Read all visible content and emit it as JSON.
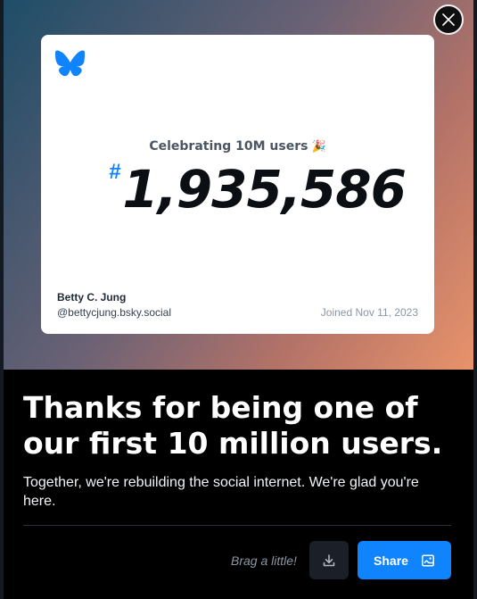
{
  "colors": {
    "accent": "#1083fe",
    "hero_gradient": [
      "#1e4d68",
      "#6c6275",
      "#b37268",
      "#e8936a"
    ]
  },
  "dialog": {
    "close_icon": "close-icon"
  },
  "card": {
    "logo_icon": "bluesky-butterfly-icon",
    "celebrating": "Celebrating 10M users",
    "celebrating_emoji": "🎉",
    "hash": "#",
    "user_number": "1,935,586",
    "name": "Betty C. Jung",
    "handle": "@bettycjung.bsky.social",
    "joined": "Joined Nov 11, 2023"
  },
  "content": {
    "headline": "Thanks for being one of our first 10 million users.",
    "subtext": "Together, we're rebuilding the social internet. We're glad you're here."
  },
  "actions": {
    "brag_label": "Brag a little!",
    "download_icon": "download-icon",
    "share_label": "Share",
    "share_icon": "share-image-icon"
  }
}
